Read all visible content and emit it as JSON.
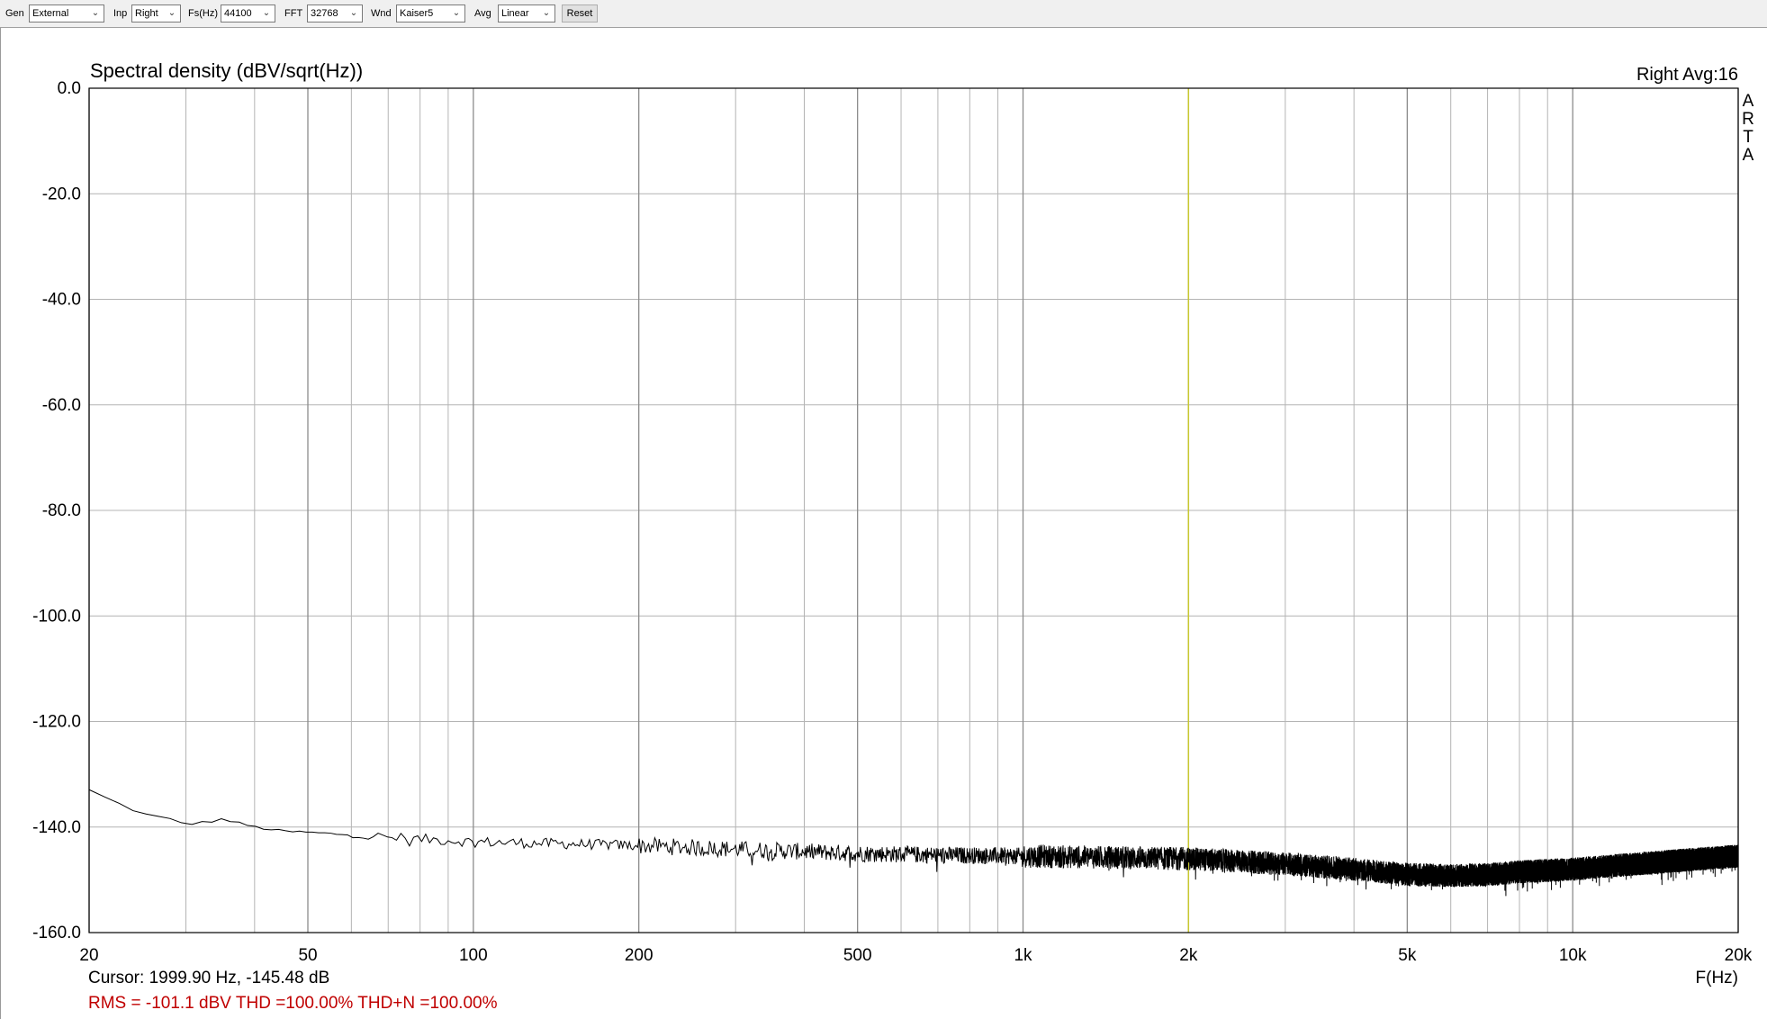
{
  "toolbar": {
    "gen": {
      "label": "Gen",
      "value": "External"
    },
    "inp": {
      "label": "Inp",
      "value": "Right"
    },
    "fs": {
      "label": "Fs(Hz)",
      "value": "44100"
    },
    "fft": {
      "label": "FFT",
      "value": "32768"
    },
    "wnd": {
      "label": "Wnd",
      "value": "Kaiser5"
    },
    "avg": {
      "label": "Avg",
      "value": "Linear"
    },
    "reset_label": "Reset"
  },
  "chart": {
    "title": "Spectral density (dBV/sqrt(Hz))",
    "channel_info": "Right  Avg:16",
    "brand_letters": [
      "A",
      "R",
      "T",
      "A"
    ],
    "xlabel": "F(Hz)",
    "cursor_text": "Cursor: 1999.90 Hz, -145.48 dB",
    "stats_text": "RMS = -101.1 dBV  THD =100.00%  THD+N =100.00%",
    "colors": {
      "trace": "#000000",
      "cursor_line": "#c8c830",
      "grid": "#b4b4b4",
      "stats_text": "#c00000"
    }
  },
  "chart_data": {
    "type": "line",
    "xscale": "log",
    "xlim": [
      20,
      20000
    ],
    "ylim": [
      -160,
      0
    ],
    "ylabel": "",
    "y_ticks": [
      0,
      -20,
      -40,
      -60,
      -80,
      -100,
      -120,
      -140,
      -160
    ],
    "y_tick_labels": [
      "0.0",
      "-20.0",
      "-40.0",
      "-60.0",
      "-80.0",
      "-100.0",
      "-120.0",
      "-140.0",
      "-160.0"
    ],
    "x_ticks": [
      20,
      50,
      100,
      200,
      500,
      1000,
      2000,
      5000,
      10000,
      20000
    ],
    "x_tick_labels": [
      "20",
      "50",
      "100",
      "200",
      "500",
      "1k",
      "2k",
      "5k",
      "10k",
      "20k"
    ],
    "x_minor_grid": [
      30,
      40,
      60,
      70,
      80,
      90,
      300,
      400,
      600,
      700,
      800,
      900,
      3000,
      4000,
      6000,
      7000,
      8000,
      9000
    ],
    "grid": true,
    "cursor_x": 1999.9,
    "cursor_y": -145.48,
    "series": [
      {
        "x": [
          20,
          22,
          25,
          28,
          30,
          33,
          35,
          40,
          45,
          50,
          60,
          70,
          80,
          90,
          100,
          150,
          200,
          300,
          500,
          700,
          1000,
          1500,
          2000,
          3000,
          4000,
          5000,
          6000,
          7000,
          8000,
          10000,
          12000,
          15000,
          20000
        ],
        "values": [
          -133,
          -135,
          -137.5,
          -138.5,
          -139.5,
          -139,
          -138.5,
          -140,
          -140.8,
          -141,
          -141.5,
          -142,
          -142.3,
          -142.5,
          -142.8,
          -143.2,
          -143.5,
          -144.2,
          -145,
          -145.3,
          -145.5,
          -145.8,
          -146,
          -147,
          -148,
          -149,
          -149.2,
          -149,
          -148.5,
          -148,
          -147.3,
          -146.5,
          -145.5
        ]
      }
    ]
  }
}
